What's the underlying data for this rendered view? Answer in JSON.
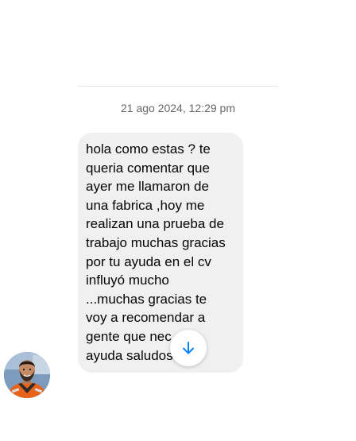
{
  "conversation": {
    "timestamp": "21 ago 2024, 12:29 pm",
    "message": {
      "lines": [
        "hola como estas ? te",
        "queria comentar que",
        "ayer me llamaron de",
        "una fabrica ,hoy me",
        "realizan una prueba de",
        "trabajo muchas gracias",
        "por tu ayuda en el cv",
        "influyó mucho",
        "...muchas gracias te",
        "voy a recomendar a",
        "gente que nec",
        "ayuda saludos"
      ]
    }
  },
  "icons": {
    "scroll_down": "arrow-down-icon",
    "avatar": "avatar"
  },
  "colors": {
    "accent": "#0084ff",
    "bubble": "#f0f0f0",
    "timestamp": "#65676b"
  }
}
